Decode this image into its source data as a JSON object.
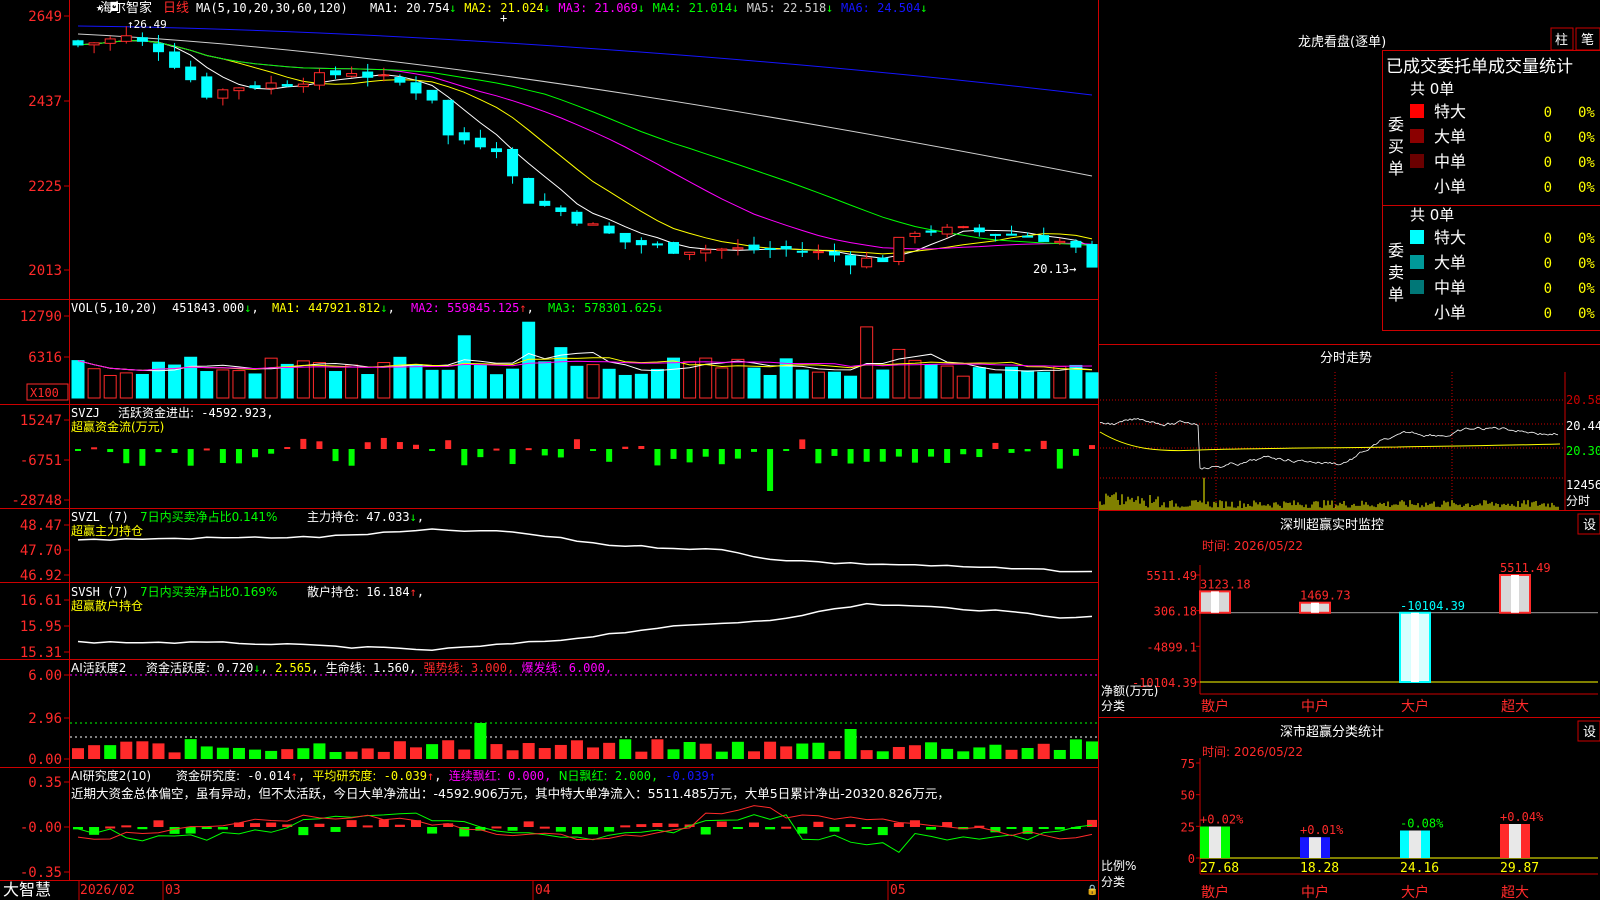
{
  "colors": {
    "up": "#ff2a2a",
    "down": "#00ffff",
    "grid": "#cc0000",
    "white": "#ffffff",
    "yellow": "#ffff00",
    "magenta": "#ff00ff",
    "green": "#00ff00",
    "gray": "#cfcfcf",
    "blue": "#1515ff",
    "limeBar": "#00ff00"
  },
  "stock": {
    "name": "海尔智家",
    "period": "日线",
    "ma_header": "MA(5,10,20,30,60,120)"
  },
  "main": {
    "ma_values": [
      {
        "label": "MA1:",
        "value": "20.754",
        "arrow": "↓",
        "color": "#ffffff"
      },
      {
        "label": "MA2:",
        "value": "21.024",
        "arrow": "↓",
        "color": "#ffff00"
      },
      {
        "label": "MA3:",
        "value": "21.069",
        "arrow": "↓",
        "color": "#ff00ff"
      },
      {
        "label": "MA4:",
        "value": "21.014",
        "arrow": "↓",
        "color": "#00ff00"
      },
      {
        "label": "MA5:",
        "value": "22.518",
        "arrow": "↓",
        "color": "#cfcfcf"
      },
      {
        "label": "MA6:",
        "value": "24.504",
        "arrow": "↓",
        "color": "#1515ff"
      }
    ],
    "y_ticks": [
      "2649",
      "2437",
      "2225",
      "2013"
    ],
    "high_label": "26.49",
    "low_label": "20.13"
  },
  "vol": {
    "title": "VOL(5,10,20)",
    "value": "451843.000",
    "ma1": "447921.812",
    "ma2": "559845.125",
    "ma3": "578301.625",
    "y_ticks": [
      "12790",
      "6316"
    ],
    "unit": "X100"
  },
  "svzj": {
    "title": "SVZJ",
    "label": "活跃资金进出:",
    "value": "-4592.923",
    "subtitle": "超赢资金流(万元)",
    "y_ticks": [
      "15247",
      "-6751",
      "-28748"
    ]
  },
  "svzl": {
    "title": "SVZL (7)",
    "label": "7日内买卖净占比0.141%",
    "label2": "主力持仓:",
    "value": "47.033",
    "subtitle": "超赢主力持仓",
    "y_ticks": [
      "48.47",
      "47.70",
      "46.92"
    ]
  },
  "svsh": {
    "title": "SVSH (7)",
    "label": "7日内买卖净占比0.169%",
    "label2": "散户持仓:",
    "value": "16.184",
    "subtitle": "超赢散户持仓",
    "y_ticks": [
      "16.61",
      "15.95",
      "15.31"
    ]
  },
  "ai1": {
    "title": "AI活跃度2",
    "label": "资金活跃度:",
    "value": "0.720",
    "v2": "2.565",
    "life_label": "生命线:",
    "life": "1.560",
    "strong_label": "强势线:",
    "strong": "3.000",
    "burst_label": "爆发线:",
    "burst": "6.000",
    "y_ticks": [
      "6.00",
      "2.96",
      "0.00"
    ]
  },
  "ai2": {
    "title": "AI研究度2(10)",
    "label": "资金研究度:",
    "value": "-0.014",
    "avg_label": "平均研究度:",
    "avg": "-0.039",
    "cont_label": "连续飘红:",
    "cont": "0.000",
    "n_label": "N日飘红:",
    "n": "2.000",
    "last": "-0.039",
    "y_ticks": [
      "0.35",
      "-0.00",
      "-0.35"
    ],
    "comment": "近期大资金总体偏空，虽有异动，但不太活跃，今日大单净流出：-4592.906万元，其中特大单净流入：5511.485万元，大单5日累计净出-20320.826万元，"
  },
  "x_axis": {
    "labels": [
      "2026/02",
      "03",
      "04",
      "05"
    ]
  },
  "brand": "大智慧",
  "lhb": {
    "title": "龙虎看盘(逐单)",
    "btn1": "柱",
    "btn2": "笔",
    "header": "已成交委托单成交量统计",
    "buy": {
      "side": "委买单",
      "total": "共 0单",
      "rows": [
        {
          "name": "特大",
          "v": "0",
          "p": "0%",
          "color": "#ff0000"
        },
        {
          "name": "大单",
          "v": "0",
          "p": "0%",
          "color": "#8b0000"
        },
        {
          "name": "中单",
          "v": "0",
          "p": "0%",
          "color": "#6a0000"
        },
        {
          "name": "小单",
          "v": "0",
          "p": "0%",
          "color": "#000000"
        }
      ]
    },
    "sell": {
      "side": "委卖单",
      "total": "共 0单",
      "rows": [
        {
          "name": "特大",
          "v": "0",
          "p": "0%",
          "color": "#00ffff"
        },
        {
          "name": "大单",
          "v": "0",
          "p": "0%",
          "color": "#009999"
        },
        {
          "name": "中单",
          "v": "0",
          "p": "0%",
          "color": "#007777"
        },
        {
          "name": "小单",
          "v": "0",
          "p": "0%",
          "color": "#000000"
        }
      ]
    }
  },
  "fenshi": {
    "title": "分时走势",
    "y_labels": [
      "20.58",
      "20.44",
      "20.30"
    ],
    "vol_label": "12456",
    "vol_unit": "分时"
  },
  "monitor": {
    "title": "深圳超赢实时监控",
    "btn": "设",
    "time": "时间: 2026/05/22",
    "y_ticks": [
      "5511.49",
      "306.18",
      "-4899.1",
      "-10104.39"
    ],
    "unit": "净额(万元)",
    "cat_title": "分类",
    "cats": [
      "散户",
      "中户",
      "大户",
      "超大"
    ],
    "values": [
      "3123.18",
      "1469.73",
      "-10104.39",
      "5511.49"
    ]
  },
  "classify": {
    "title": "深市超赢分类统计",
    "btn": "设",
    "time": "时间: 2026/05/22",
    "y_ticks": [
      "75",
      "50",
      "25",
      "0"
    ],
    "unit": "比例%",
    "cat_title": "分类",
    "cats": [
      "散户",
      "中户",
      "大户",
      "超大"
    ],
    "pct_changes": [
      "+0.02%",
      "+0.01%",
      "-0.08%",
      "+0.04%"
    ],
    "values": [
      "27.68",
      "18.28",
      "24.16",
      "29.87"
    ]
  },
  "chart_data": {
    "type": "bar",
    "title": "深圳超赢实时监控",
    "ylabel": "净额(万元)",
    "categories": [
      "散户",
      "中户",
      "大户",
      "超大"
    ],
    "values": [
      3123.18,
      1469.73,
      -10104.39,
      5511.49
    ],
    "ylim": [
      -10104.39,
      5511.49
    ],
    "secondary": {
      "title": "深市超赢分类统计",
      "ylabel": "比例%",
      "categories": [
        "散户",
        "中户",
        "大户",
        "超大"
      ],
      "values": [
        27.68,
        18.28,
        24.16,
        29.87
      ],
      "ylim": [
        0,
        75
      ]
    }
  }
}
